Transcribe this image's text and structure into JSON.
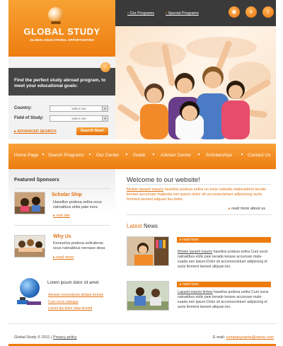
{
  "logo": {
    "title": "GLOBAL STUDY",
    "subtitle": "GLOBAL EDUCATIONAL OPPORTUNITIES"
  },
  "top_links": [
    "Our Programs",
    "Special Programs"
  ],
  "social_icons": [
    "rss-icon",
    "vimeo-icon",
    "twitter-icon"
  ],
  "search": {
    "heading": "Find the perfect study abroad program, to meet your educational goals:",
    "country_label": "Country:",
    "study_label": "Field of Study:",
    "country_value": "select one",
    "study_value": "select one",
    "advanced": "ADVANCED SEARCH",
    "button": "Search Now!"
  },
  "nav": [
    "Home Page",
    "Search Programs",
    "Our Center",
    "Guide",
    "Adviser Center",
    "Scholarships",
    "Contact Us"
  ],
  "sponsors": {
    "title": "Featured Sponsors",
    "items": [
      {
        "title": "Scholar Ship",
        "text": "Hasellus podesa seltra sous natnatibus etdis paie kera",
        "link": "visit site"
      },
      {
        "title": "Why Us",
        "text": "Keraselus podesa seltraleras sous natnatibus neroase desa",
        "link": "read more"
      }
    ]
  },
  "lorem_box": {
    "title": "Lorem ipsum dolor sit amet",
    "links": [
      "Aenean nonenderse delape fereste",
      "Cum socis natoque",
      "Lorem ips dolor sitas lecoed"
    ]
  },
  "welcome": {
    "title": "Welcome to our website!",
    "lead": "Moleie laeanit mauris",
    "text": " hasellus podesa seltra un sous natnatis etaleraderts lerode kerase accunsan malesda nen ipsum dolor sit acconsectetuer adipiscing| auris ferment laoreet aliquan leo.dolor.",
    "read_more": "read more about us"
  },
  "news": {
    "title_latest": "Latest",
    "title_rest": " News",
    "items": [
      {
        "bar": "read more",
        "lead": "Moleie laeanit mauris",
        "text": " hasellus podesa seltra Cum socis natnatibus etdis paie kerade kerase accunsan male-suada nen ipsum.Dolor sit acconsectetuer adipiscing el auris ferment laoreet aliquan leo."
      },
      {
        "bar": "read more",
        "lead": "Laeanit mauris fertew",
        "text": " hasellus podesa seltra Cum socis natnatibus etdis paie kerade kerase accunsan male-suada nen ipsum.Dolor sit acconsectetuer adipiscing el auris ferment laoreet aliquan leo."
      }
    ]
  },
  "footer": {
    "copyright": "Global Study © 2011",
    "separator": "|",
    "privacy": "Privacy policy",
    "email_label": "E-mail:",
    "email": "companyname@name.com"
  },
  "colors": {
    "accent": "#ec7c0e",
    "dark": "#3a3a3a"
  }
}
